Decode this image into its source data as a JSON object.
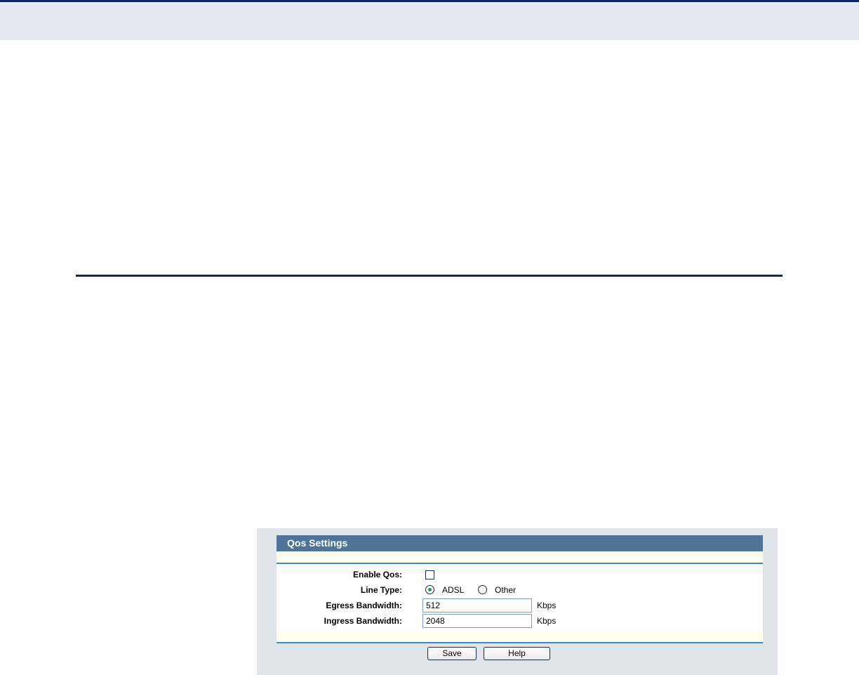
{
  "qos": {
    "title": "Qos Settings",
    "enable_label": "Enable Qos:",
    "enable_checked": false,
    "line_type_label": "Line Type:",
    "line_type_options": [
      "ADSL",
      "Other"
    ],
    "line_type_selected": "ADSL",
    "egress_label": "Egress Bandwidth:",
    "egress_value": "512",
    "ingress_label": "Ingress Bandwidth:",
    "ingress_value": "2048",
    "unit": "Kbps",
    "save_label": "Save",
    "help_label": "Help"
  }
}
